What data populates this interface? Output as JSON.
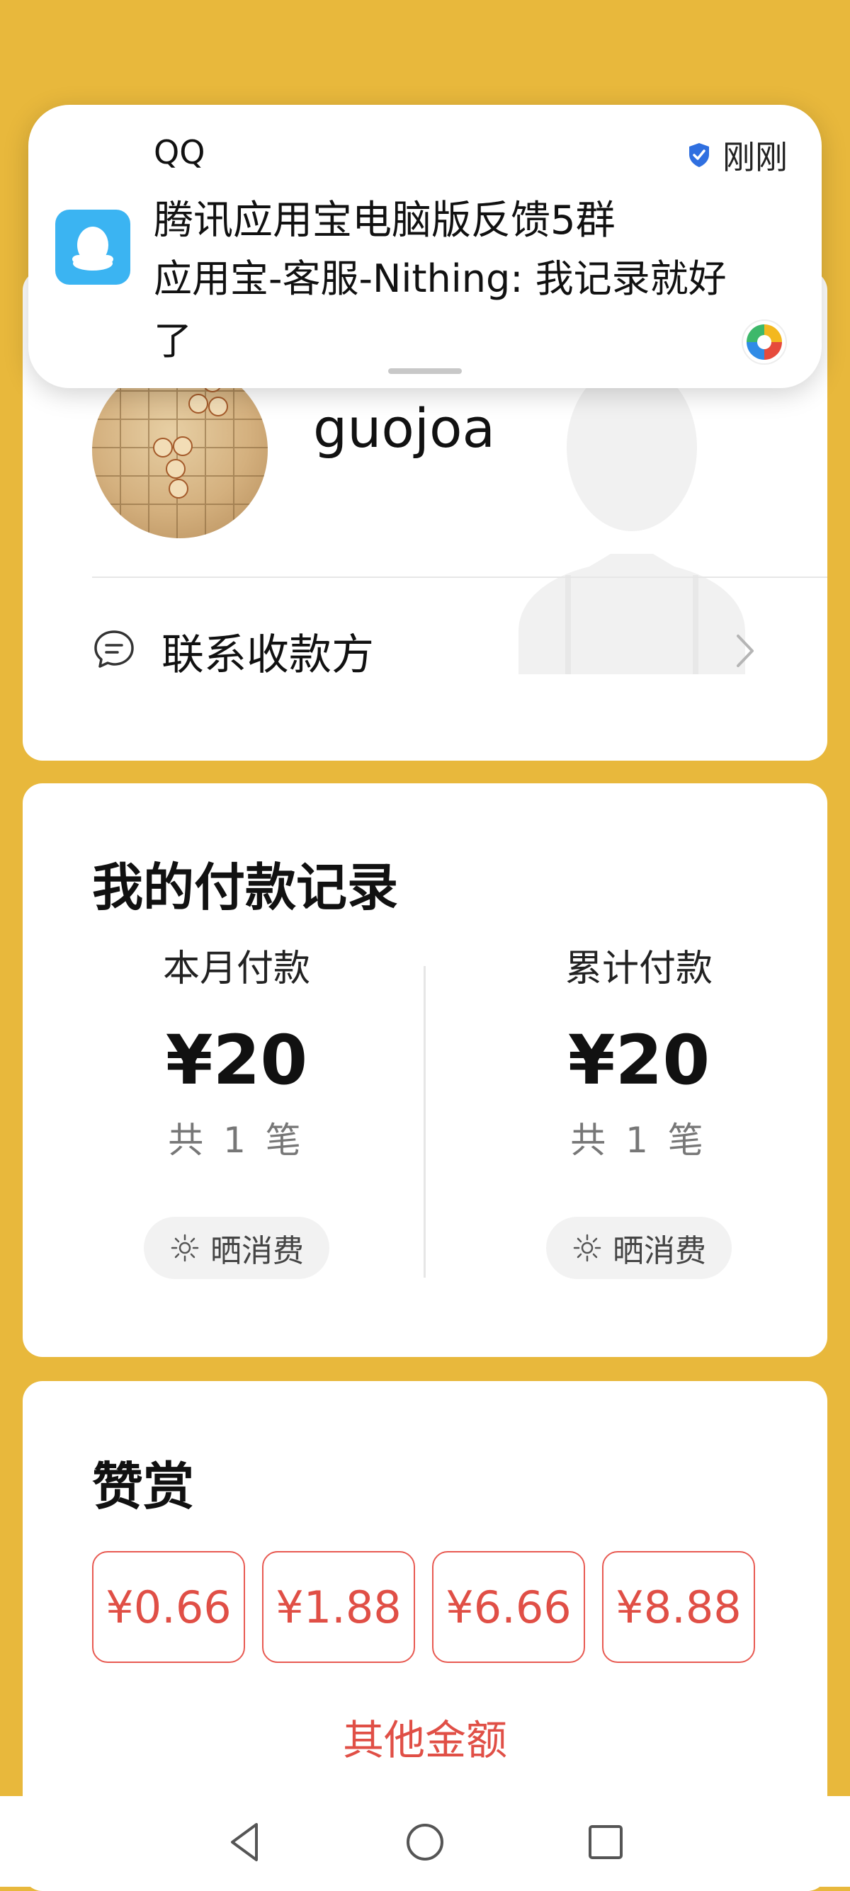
{
  "notification": {
    "app_name": "QQ",
    "time": "刚刚",
    "title": "腾讯应用宝电脑版反馈5群",
    "message": "应用宝-客服-Nithing: 我记录就好了"
  },
  "payee": {
    "name": "guojoa",
    "contact_label": "联系收款方"
  },
  "payment_records": {
    "title": "我的付款记录",
    "this_month": {
      "label": "本月付款",
      "amount": "¥20",
      "count": "共 1 笔",
      "show_label": "晒消费"
    },
    "total": {
      "label": "累计付款",
      "amount": "¥20",
      "count": "共 1 笔",
      "show_label": "晒消费"
    }
  },
  "tip": {
    "title": "赞赏",
    "amounts": [
      "¥0.66",
      "¥1.88",
      "¥6.66",
      "¥8.88"
    ],
    "other_label": "其他金额"
  },
  "colors": {
    "background": "#E8B83C",
    "accent_red": "#E04F46",
    "qq_blue": "#3BB4F2"
  }
}
